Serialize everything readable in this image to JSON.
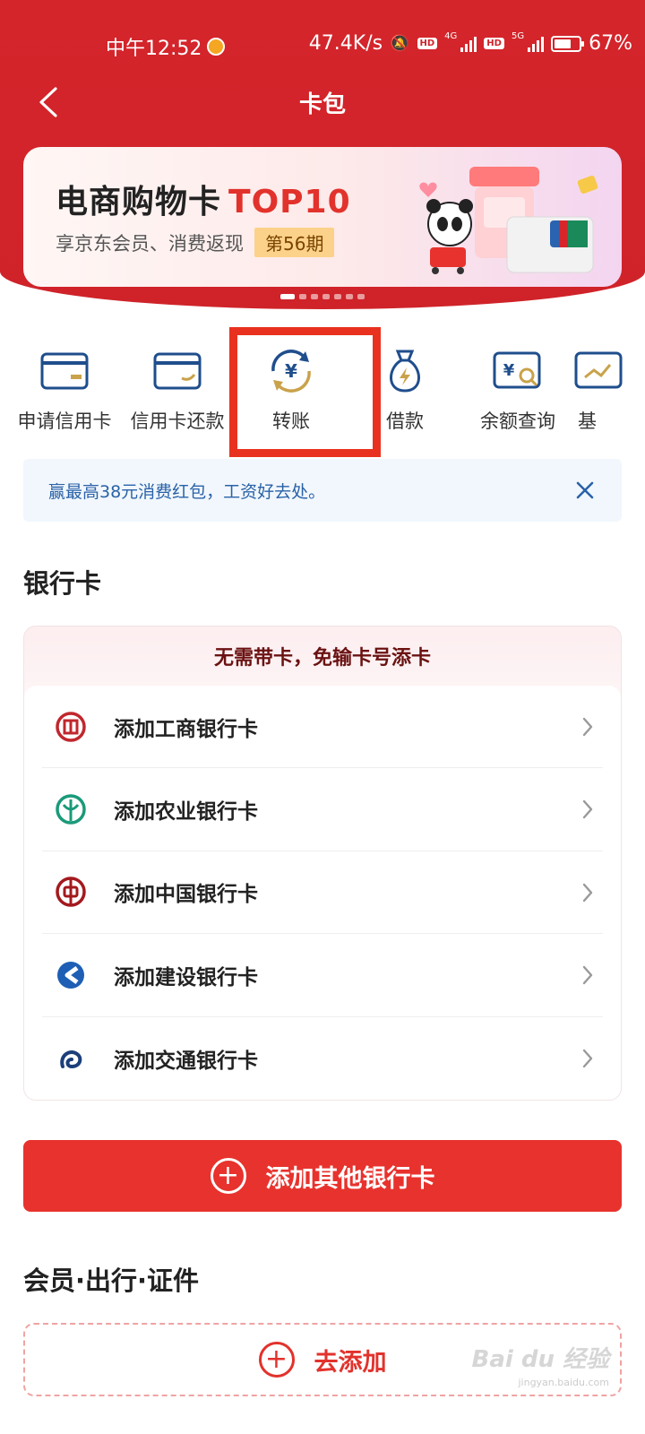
{
  "status_bar": {
    "time": "中午12:52",
    "network_speed": "47.4K/s",
    "hd1": "HD",
    "net1": "4G",
    "hd2": "HD",
    "net2": "5G",
    "battery_percent": "67%",
    "battery_level": 0.67
  },
  "nav": {
    "title": "卡包",
    "back_icon": "back-arrow-icon"
  },
  "banner": {
    "title": "电商购物卡",
    "title_highlight": "TOP10",
    "subtitle": "享京东会员、消费返现",
    "issue": "第56期",
    "page_count": 7,
    "active_page": 0
  },
  "quick_actions": [
    {
      "label": "申请信用卡",
      "icon": "credit-card-icon"
    },
    {
      "label": "信用卡还款",
      "icon": "card-repay-icon"
    },
    {
      "label": "转账",
      "icon": "transfer-yuan-icon",
      "highlighted": true
    },
    {
      "label": "借款",
      "icon": "loan-bag-icon"
    },
    {
      "label": "余额查询",
      "icon": "balance-search-icon"
    },
    {
      "label": "基",
      "icon": "fund-icon"
    }
  ],
  "promo": {
    "text": "赢最高38元消费红包，工资好去处。",
    "close_icon": "close-icon"
  },
  "bank_section": {
    "title": "银行卡",
    "box_header": "无需带卡，免输卡号添卡",
    "banks": [
      {
        "label": "添加工商银行卡",
        "icon": "icbc-logo-icon"
      },
      {
        "label": "添加农业银行卡",
        "icon": "abc-logo-icon"
      },
      {
        "label": "添加中国银行卡",
        "icon": "boc-logo-icon"
      },
      {
        "label": "添加建设银行卡",
        "icon": "ccb-logo-icon"
      },
      {
        "label": "添加交通银行卡",
        "icon": "bocom-logo-icon"
      }
    ],
    "add_other": "添加其他银行卡"
  },
  "membership_section": {
    "title": "会员·出行·证件",
    "add_label": "去添加"
  },
  "watermark": {
    "text": "Bai du 经验",
    "sub": "jingyan.baidu.com"
  },
  "colors": {
    "brand_red": "#d4252b",
    "button_red": "#e8322d",
    "highlight_box": "#e8321f",
    "promo_blue": "#2a62a8"
  }
}
